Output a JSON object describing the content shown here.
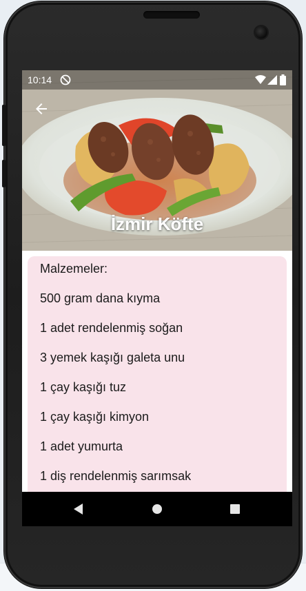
{
  "status_bar": {
    "time": "10:14",
    "icons": [
      "do-not-disturb-icon",
      "wifi-icon",
      "signal-icon",
      "battery-icon"
    ]
  },
  "recipe": {
    "title": "İzmir Köfte",
    "ingredients_heading": "Malzemeler:",
    "ingredients": [
      "500 gram dana kıyma",
      "1 adet rendelenmiş soğan",
      "3 yemek kaşığı galeta unu",
      "1 çay kaşığı tuz",
      "1 çay kaşığı kimyon",
      "1 adet yumurta",
      "1 diş rendelenmiş sarımsak"
    ]
  },
  "navigation": {
    "back_icon": "arrow-back-icon",
    "system_buttons": [
      "nav-back-icon",
      "nav-home-icon",
      "nav-recent-apps-icon"
    ]
  },
  "colors": {
    "card_background": "#f9e3ea",
    "title_text": "#ffffff",
    "nav_bar": "#000000"
  }
}
